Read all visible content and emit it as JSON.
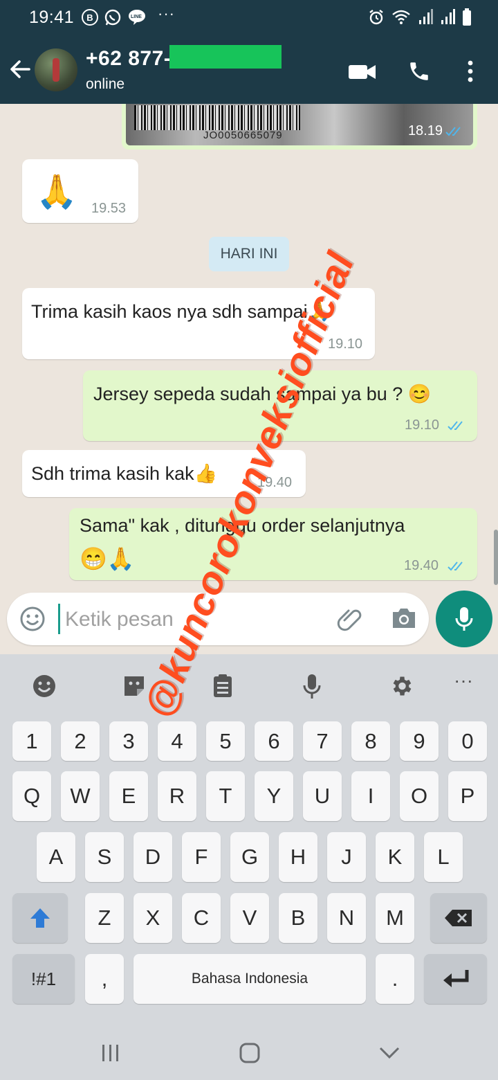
{
  "status_bar": {
    "time": "19:41",
    "notif_badge": "B",
    "more": "···"
  },
  "header": {
    "contact_name": "+62 877-",
    "contact_status": "online"
  },
  "chat": {
    "image_message": {
      "code": "JO0050665079",
      "time": "18.19"
    },
    "messages": [
      {
        "dir": "in",
        "text": "🙏",
        "time": "19.53"
      },
      {
        "dir": "in",
        "text": "Trima kasih kaos nya sdh sampai🙏",
        "time": "19.10"
      },
      {
        "dir": "out",
        "text": "Jersey sepeda sudah sampai ya bu ? 😊",
        "time": "19.10"
      },
      {
        "dir": "in",
        "text": "Sdh trima kasih kak👍",
        "time": "19.40"
      },
      {
        "dir": "out",
        "text": "Sama\" kak , ditunggu order selanjutnya",
        "text2": "😁🙏",
        "time": "19.40"
      }
    ],
    "day_separator": "HARI INI",
    "watermark": "@kuncorokonveksiofficial"
  },
  "composer": {
    "placeholder": "Ketik pesan"
  },
  "keyboard": {
    "row_numbers": [
      "1",
      "2",
      "3",
      "4",
      "5",
      "6",
      "7",
      "8",
      "9",
      "0"
    ],
    "row_top": [
      "Q",
      "W",
      "E",
      "R",
      "T",
      "Y",
      "U",
      "I",
      "O",
      "P"
    ],
    "row_mid": [
      "A",
      "S",
      "D",
      "F",
      "G",
      "H",
      "J",
      "K",
      "L"
    ],
    "row_bot": [
      "Z",
      "X",
      "C",
      "V",
      "B",
      "N",
      "M"
    ],
    "symbols_key": "!#1",
    "comma_key": ",",
    "space_label": "Bahasa Indonesia",
    "period_key": ".",
    "toolbar_more": "···"
  },
  "colors": {
    "header_bg": "#1d3a47",
    "incoming_bubble": "#ffffff",
    "outgoing_bubble": "#e2f7cb",
    "accent": "#0f8d7c",
    "read_ticks": "#4fb6ec",
    "watermark": "#ff4d1f"
  }
}
